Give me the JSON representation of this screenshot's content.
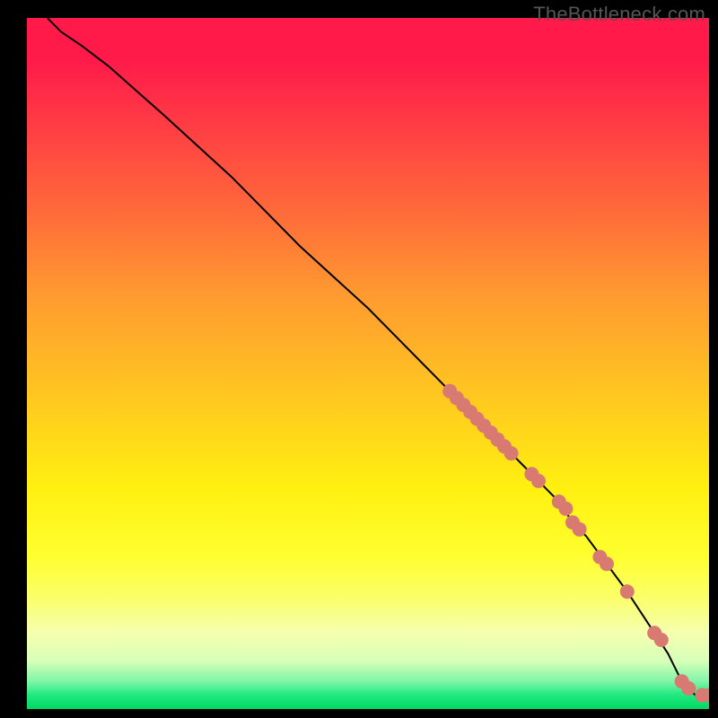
{
  "watermark": "TheBottleneck.com",
  "chart_data": {
    "type": "line",
    "title": "",
    "xlabel": "",
    "ylabel": "",
    "xlim": [
      0,
      100
    ],
    "ylim": [
      0,
      100
    ],
    "curve": {
      "x": [
        3,
        5,
        8,
        12,
        20,
        30,
        40,
        50,
        58,
        62,
        65,
        68,
        70,
        73,
        75,
        78,
        80,
        82,
        85,
        88,
        90,
        92,
        94,
        95,
        96,
        97,
        98,
        100
      ],
      "y": [
        100,
        98,
        96,
        93,
        86,
        77,
        67,
        58,
        50,
        46,
        43,
        40,
        38,
        35,
        33,
        30,
        27,
        25,
        21,
        17,
        14,
        11,
        8,
        6,
        4,
        3,
        2,
        2
      ]
    },
    "scatter_points": {
      "x": [
        62,
        63,
        64,
        65,
        66,
        67,
        68,
        69,
        70,
        71,
        74,
        75,
        78,
        79,
        80,
        81,
        84,
        85,
        88,
        92,
        93,
        96,
        97,
        99,
        100
      ],
      "y": [
        46,
        45,
        44,
        43,
        42,
        41,
        40,
        39,
        38,
        37,
        34,
        33,
        30,
        29,
        27,
        26,
        22,
        21,
        17,
        11,
        10,
        4,
        3,
        2,
        2
      ]
    }
  }
}
